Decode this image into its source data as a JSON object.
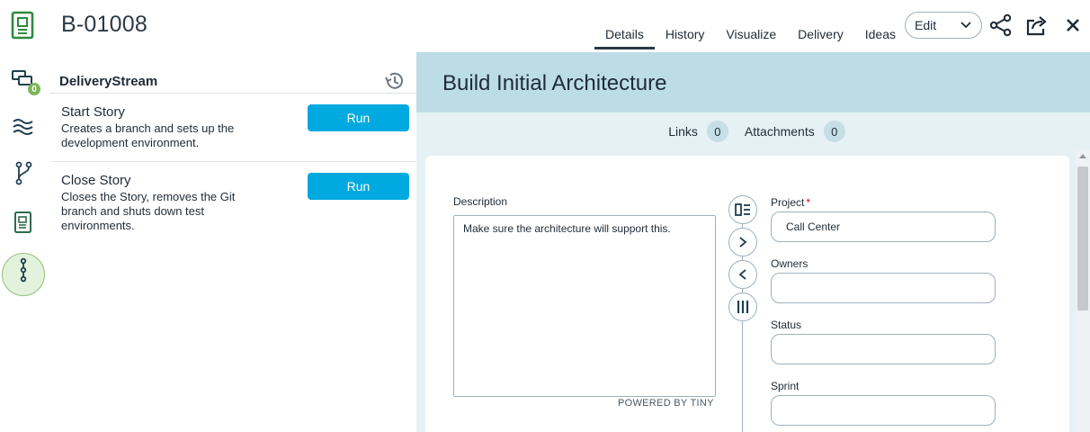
{
  "header": {
    "asset_id": "B-01008",
    "tabs": [
      {
        "label": "Details",
        "active": true
      },
      {
        "label": "History",
        "active": false
      },
      {
        "label": "Visualize",
        "active": false
      },
      {
        "label": "Delivery",
        "active": false
      },
      {
        "label": "Ideas",
        "active": false
      }
    ],
    "edit_label": "Edit",
    "icons": [
      "story-icon",
      "share-icon",
      "export-icon",
      "close-icon"
    ]
  },
  "rail": {
    "icons": [
      "conversations-icon",
      "deliverystream-icon",
      "branch-icon",
      "story-detail-icon",
      "dependency-icon"
    ],
    "conversations_badge": "0",
    "active": "story-detail-icon"
  },
  "delivery_stream": {
    "title": "DeliveryStream",
    "items": [
      {
        "title": "Start Story",
        "description": "Creates a branch and sets up the development environment.",
        "button": "Run"
      },
      {
        "title": "Close Story",
        "description": "Closes the Story, removes the Git branch and shuts down test environments.",
        "button": "Run"
      }
    ]
  },
  "detail": {
    "title": "Build Initial Architecture",
    "links_label": "Links",
    "links_count": "0",
    "attachments_label": "Attachments",
    "attachments_count": "0",
    "description_label": "Description",
    "description_value": "Make sure the architecture will support this.",
    "powered_by": "POWERED BY TINY",
    "fields": [
      {
        "label": "Project",
        "required": true,
        "value": "Call Center"
      },
      {
        "label": "Owners",
        "required": false,
        "value": ""
      },
      {
        "label": "Status",
        "required": false,
        "value": ""
      },
      {
        "label": "Sprint",
        "required": false,
        "value": ""
      }
    ],
    "required_mark": "*"
  },
  "colors": {
    "accent": "#00a9e0",
    "brand_green": "#2e8b3e",
    "title_band": "#bcdde6",
    "detail_bg": "#e6f1f5"
  }
}
